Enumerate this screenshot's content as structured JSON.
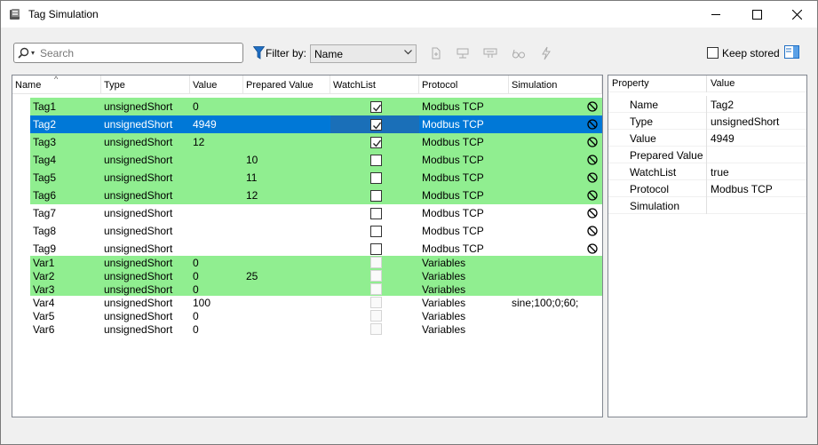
{
  "window": {
    "title": "Tag Simulation",
    "minimize_icon": "minimize-icon",
    "maximize_icon": "maximize-icon",
    "close_icon": "close-icon"
  },
  "toolbar": {
    "search_placeholder": "Search",
    "filter_label": "Filter by:",
    "filter_value": "Name",
    "keep_stored_label": "Keep stored",
    "keep_stored_checked": false,
    "icons": [
      "new-document-icon",
      "network-icon",
      "device-icon",
      "glasses-icon",
      "lightning-icon"
    ]
  },
  "grid": {
    "columns": [
      "Name",
      "Type",
      "Value",
      "Prepared Value",
      "WatchList",
      "Protocol",
      "Simulation"
    ],
    "rows": [
      {
        "name": "Tag1",
        "type": "unsignedShort",
        "value": "0",
        "prepared": "",
        "watch": "checked",
        "protocol": "Modbus TCP",
        "simulation": "",
        "nosim": true,
        "green": true,
        "selected": false
      },
      {
        "name": "Tag2",
        "type": "unsignedShort",
        "value": "4949",
        "prepared": "",
        "watch": "checked",
        "protocol": "Modbus TCP",
        "simulation": "",
        "nosim": true,
        "green": true,
        "selected": true
      },
      {
        "name": "Tag3",
        "type": "unsignedShort",
        "value": "12",
        "prepared": "",
        "watch": "checked",
        "protocol": "Modbus TCP",
        "simulation": "",
        "nosim": true,
        "green": true,
        "selected": false
      },
      {
        "name": "Tag4",
        "type": "unsignedShort",
        "value": "",
        "prepared": "10",
        "watch": "unchecked",
        "protocol": "Modbus TCP",
        "simulation": "",
        "nosim": true,
        "green": true,
        "selected": false
      },
      {
        "name": "Tag5",
        "type": "unsignedShort",
        "value": "",
        "prepared": "11",
        "watch": "unchecked",
        "protocol": "Modbus TCP",
        "simulation": "",
        "nosim": true,
        "green": true,
        "selected": false
      },
      {
        "name": "Tag6",
        "type": "unsignedShort",
        "value": "",
        "prepared": "12",
        "watch": "unchecked",
        "protocol": "Modbus TCP",
        "simulation": "",
        "nosim": true,
        "green": true,
        "selected": false
      },
      {
        "name": "Tag7",
        "type": "unsignedShort",
        "value": "",
        "prepared": "",
        "watch": "unchecked",
        "protocol": "Modbus TCP",
        "simulation": "",
        "nosim": true,
        "green": false,
        "selected": false
      },
      {
        "name": "Tag8",
        "type": "unsignedShort",
        "value": "",
        "prepared": "",
        "watch": "unchecked",
        "protocol": "Modbus TCP",
        "simulation": "",
        "nosim": true,
        "green": false,
        "selected": false
      },
      {
        "name": "Tag9",
        "type": "unsignedShort",
        "value": "",
        "prepared": "",
        "watch": "unchecked",
        "protocol": "Modbus TCP",
        "simulation": "",
        "nosim": true,
        "green": false,
        "selected": false
      },
      {
        "name": "Var1",
        "type": "unsignedShort",
        "value": "0",
        "prepared": "",
        "watch": "disabled",
        "protocol": "Variables",
        "simulation": "",
        "nosim": false,
        "green": true,
        "selected": false
      },
      {
        "name": "Var2",
        "type": "unsignedShort",
        "value": "0",
        "prepared": "25",
        "watch": "disabled",
        "protocol": "Variables",
        "simulation": "",
        "nosim": false,
        "green": true,
        "selected": false
      },
      {
        "name": "Var3",
        "type": "unsignedShort",
        "value": "0",
        "prepared": "",
        "watch": "disabled",
        "protocol": "Variables",
        "simulation": "",
        "nosim": false,
        "green": true,
        "selected": false
      },
      {
        "name": "Var4",
        "type": "unsignedShort",
        "value": "100",
        "prepared": "",
        "watch": "disabled",
        "protocol": "Variables",
        "simulation": "sine;100;0;60;",
        "nosim": false,
        "green": false,
        "selected": false
      },
      {
        "name": "Var5",
        "type": "unsignedShort",
        "value": "0",
        "prepared": "",
        "watch": "disabled",
        "protocol": "Variables",
        "simulation": "",
        "nosim": false,
        "green": false,
        "selected": false
      },
      {
        "name": "Var6",
        "type": "unsignedShort",
        "value": "0",
        "prepared": "",
        "watch": "disabled",
        "protocol": "Variables",
        "simulation": "",
        "nosim": false,
        "green": false,
        "selected": false
      }
    ]
  },
  "properties": {
    "header_property": "Property",
    "header_value": "Value",
    "items": [
      {
        "name": "Name",
        "value": "Tag2"
      },
      {
        "name": "Type",
        "value": "unsignedShort"
      },
      {
        "name": "Value",
        "value": "4949"
      },
      {
        "name": "Prepared Value",
        "value": ""
      },
      {
        "name": "WatchList",
        "value": "true"
      },
      {
        "name": "Protocol",
        "value": "Modbus TCP"
      },
      {
        "name": "Simulation",
        "value": ""
      }
    ]
  },
  "colors": {
    "row_green": "#90ee90",
    "selection": "#0078d7",
    "selection_text": "#ffffff"
  }
}
